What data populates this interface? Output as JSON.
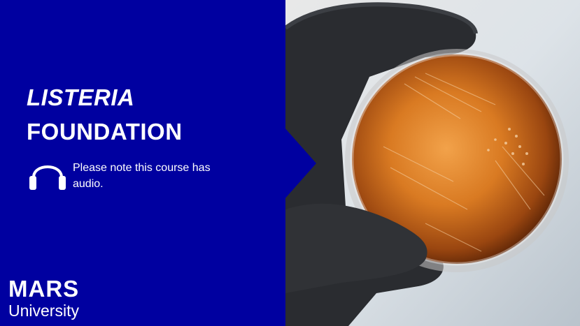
{
  "course": {
    "title_line1": "LISTERIA",
    "title_line2": "FOUNDATION",
    "audio_note": "Please note this course has audio."
  },
  "brand": {
    "name": "MARS",
    "subtitle": "University",
    "panel_color": "#0000a0"
  },
  "icons": {
    "audio": "headphones-icon"
  },
  "image": {
    "subject": "gloved hand holding a petri dish with orange agar and bacterial colonies"
  }
}
